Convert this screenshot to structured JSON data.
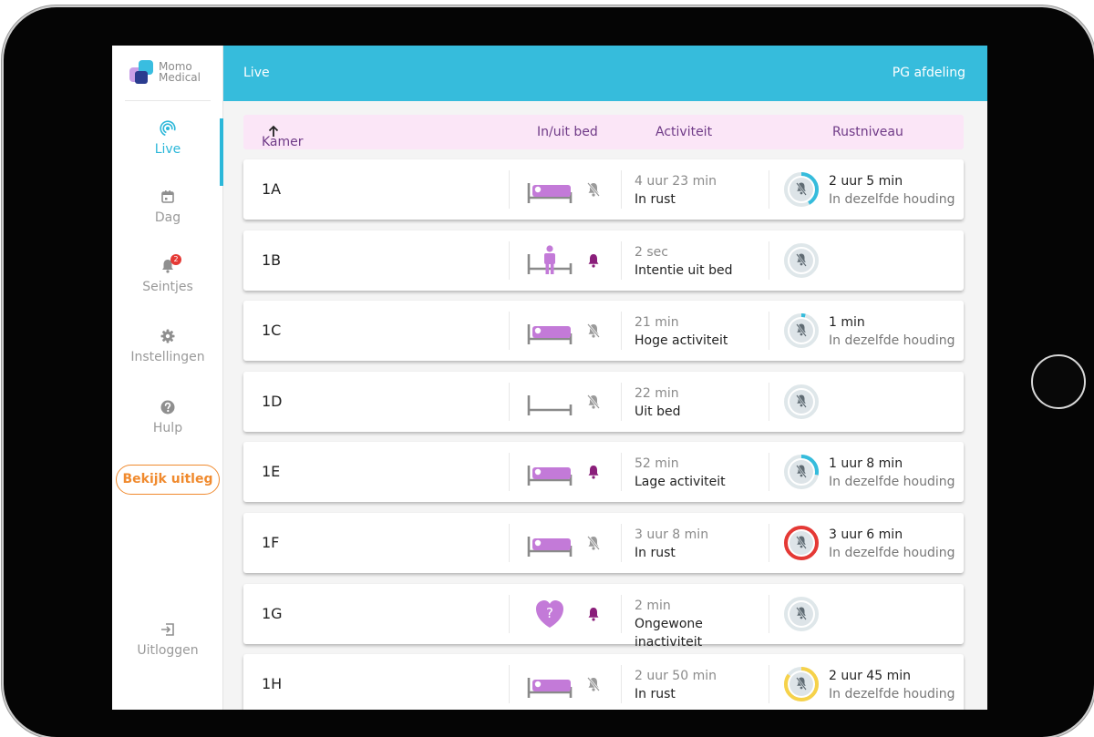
{
  "app": {
    "logo_line1": "Momo",
    "logo_line2": "Medical"
  },
  "colors": {
    "primary": "#36bcdc",
    "accent_purple": "#c37ad8",
    "bell_purple": "#8a1e7a",
    "explain_orange": "#f08a2e",
    "alert_red": "#e53935",
    "warn_yellow": "#f6d24a",
    "header_pink": "#fbe6f7"
  },
  "sidebar": {
    "items": [
      {
        "key": "live",
        "label": "Live",
        "icon": "signal-icon",
        "active": true
      },
      {
        "key": "dag",
        "label": "Dag",
        "icon": "calendar-icon",
        "active": false
      },
      {
        "key": "seintjes",
        "label": "Seintjes",
        "icon": "bell-icon",
        "active": false,
        "badge": "2"
      },
      {
        "key": "instellingen",
        "label": "Instellingen",
        "icon": "gear-icon",
        "active": false
      },
      {
        "key": "hulp",
        "label": "Hulp",
        "icon": "help-icon",
        "active": false
      }
    ],
    "explain_button": "Bekijk uitleg",
    "logout_label": "Uitloggen"
  },
  "header": {
    "title": "Live",
    "ward": "PG afdeling"
  },
  "table": {
    "columns": {
      "room": "Kamer",
      "in_out_bed": "In/uit bed",
      "activity": "Activiteit",
      "rest": "Rustniveau"
    },
    "sort_icon": "arrow-up-icon",
    "rows": [
      {
        "room": "1A",
        "bed_state": "in-bed",
        "alarm": false,
        "activity_duration": "4 uur 23 min",
        "activity_state": "In rust",
        "rest_progress": 0.42,
        "rest_status": "normal",
        "rest_duration": "2 uur 5 min",
        "rest_desc": "In dezelfde houding"
      },
      {
        "room": "1B",
        "bed_state": "intent-out",
        "alarm": true,
        "activity_duration": "2 sec",
        "activity_state": "Intentie uit bed",
        "rest_progress": 0,
        "rest_status": "none",
        "rest_duration": "",
        "rest_desc": ""
      },
      {
        "room": "1C",
        "bed_state": "in-bed",
        "alarm": false,
        "activity_duration": "21 min",
        "activity_state": "Hoge activiteit",
        "rest_progress": 0.04,
        "rest_status": "normal",
        "rest_duration": "1 min",
        "rest_desc": "In dezelfde houding"
      },
      {
        "room": "1D",
        "bed_state": "out-bed",
        "alarm": false,
        "activity_duration": "22 min",
        "activity_state": "Uit bed",
        "rest_progress": 0,
        "rest_status": "none",
        "rest_duration": "",
        "rest_desc": ""
      },
      {
        "room": "1E",
        "bed_state": "in-bed",
        "alarm": true,
        "activity_duration": "52 min",
        "activity_state": "Lage activiteit",
        "rest_progress": 0.28,
        "rest_status": "normal",
        "rest_duration": "1 uur 8 min",
        "rest_desc": "In dezelfde houding"
      },
      {
        "room": "1F",
        "bed_state": "in-bed",
        "alarm": false,
        "activity_duration": "3 uur 8 min",
        "activity_state": "In rust",
        "rest_progress": 1,
        "rest_status": "alert",
        "rest_duration": "3 uur 6 min",
        "rest_desc": "In dezelfde houding"
      },
      {
        "room": "1G",
        "bed_state": "unknown",
        "alarm": true,
        "activity_duration": "2 min",
        "activity_state": "Ongewone inactiviteit",
        "rest_progress": 0,
        "rest_status": "none",
        "rest_duration": "",
        "rest_desc": ""
      },
      {
        "room": "1H",
        "bed_state": "in-bed",
        "alarm": false,
        "activity_duration": "2 uur 50 min",
        "activity_state": "In rust",
        "rest_progress": 0.85,
        "rest_status": "warning",
        "rest_duration": "2 uur 45 min",
        "rest_desc": "In dezelfde houding"
      }
    ]
  }
}
